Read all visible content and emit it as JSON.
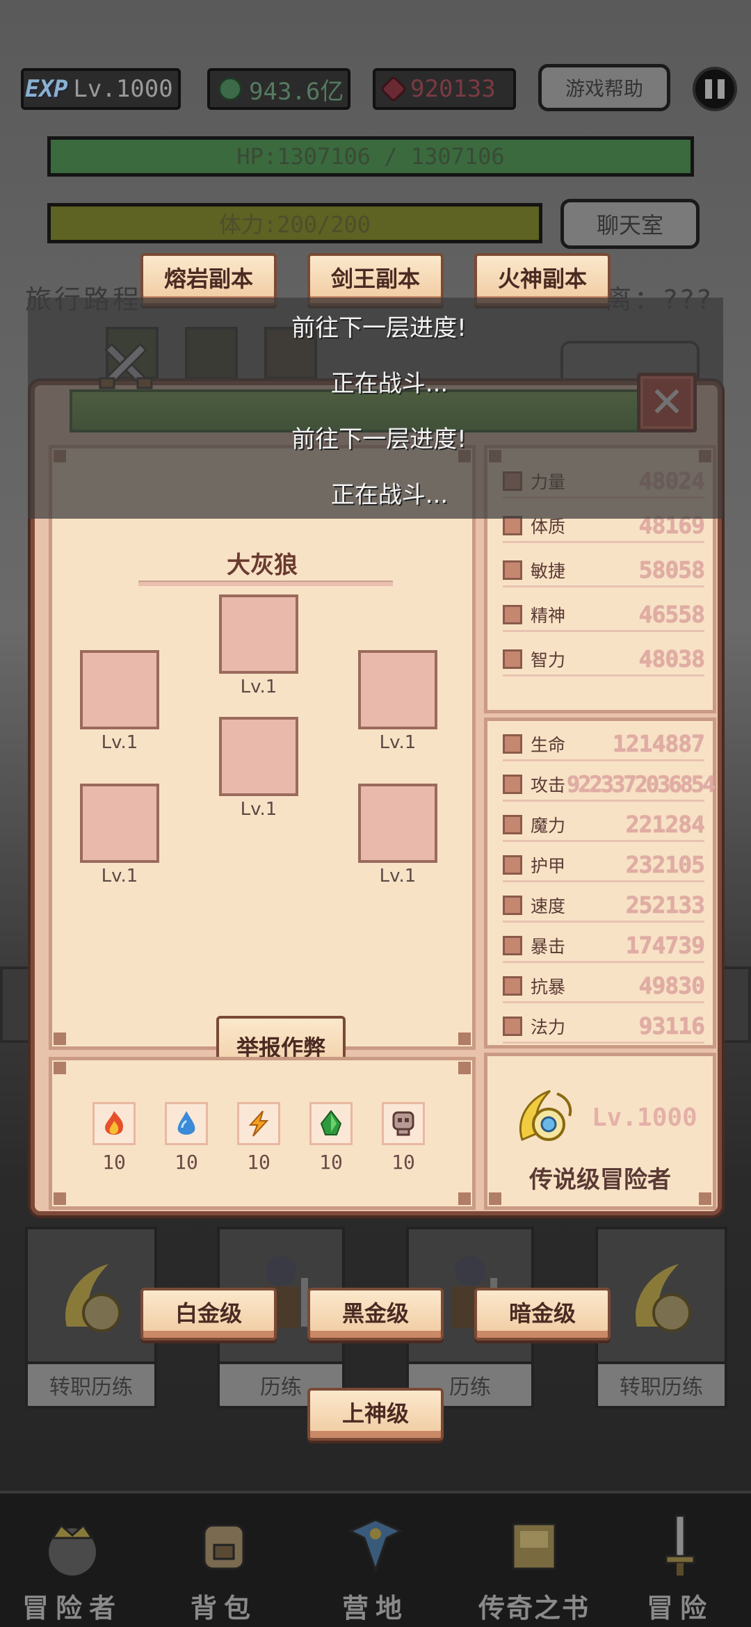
{
  "hud": {
    "exp_logo": "EXP",
    "level": "Lv.1000",
    "gold": "943.6亿",
    "gems": "920133",
    "help_label": "游戏帮助",
    "hp_text": "HP:1307106 / 1307106",
    "hp_fraction": 1.0,
    "stamina_text": "体力:200/200",
    "stamina_fraction": 1.0,
    "chat_label": "聊天室"
  },
  "dungeon_buttons": [
    "熔岩副本",
    "剑王副本",
    "火神副本"
  ],
  "background": {
    "travel_label": "旅行路程",
    "distance_label": "离：???"
  },
  "battle_log": [
    "前往下一层进度!",
    "正在战斗...",
    "前往下一层进度!",
    "正在战斗..."
  ],
  "enemy": {
    "name": "大灰狼",
    "slots": [
      "Lv.1",
      "Lv.1",
      "Lv.1",
      "Lv.1",
      "Lv.1",
      "Lv.1"
    ],
    "report_label": "举报作弊"
  },
  "elements": [
    {
      "icon": "fire-icon",
      "count": "10"
    },
    {
      "icon": "water-icon",
      "count": "10"
    },
    {
      "icon": "lightning-icon",
      "count": "10"
    },
    {
      "icon": "earth-icon",
      "count": "10"
    },
    {
      "icon": "skull-icon",
      "count": "10"
    }
  ],
  "attributes": [
    {
      "label": "力量",
      "value": "48024"
    },
    {
      "label": "体质",
      "value": "48169"
    },
    {
      "label": "敏捷",
      "value": "58058"
    },
    {
      "label": "精神",
      "value": "46558"
    },
    {
      "label": "智力",
      "value": "48038"
    }
  ],
  "stats": [
    {
      "label": "生命",
      "value": "1214887"
    },
    {
      "label": "攻击",
      "value": "9223372036854"
    },
    {
      "label": "魔力",
      "value": "221284"
    },
    {
      "label": "护甲",
      "value": "232105"
    },
    {
      "label": "速度",
      "value": "252133"
    },
    {
      "label": "暴击",
      "value": "174739"
    },
    {
      "label": "抗暴",
      "value": "49830"
    },
    {
      "label": "法力",
      "value": "93116"
    }
  ],
  "rank": {
    "level": "Lv.1000",
    "title": "传说级冒险者"
  },
  "tier_buttons": [
    "白金级",
    "黑金级",
    "暗金级",
    "上神级"
  ],
  "roster_cards": [
    "转职历练",
    "历练",
    "历练",
    "转职历练"
  ],
  "nav": [
    "冒险者",
    "背包",
    "营地",
    "传奇之书",
    "冒险"
  ],
  "colors": {
    "dialog_bg": "#f8e2c6",
    "dialog_border": "#7d4a3a",
    "header_green": "#5e9a3c",
    "close_red": "#c0392b",
    "stat_value": "#e0aca4"
  }
}
